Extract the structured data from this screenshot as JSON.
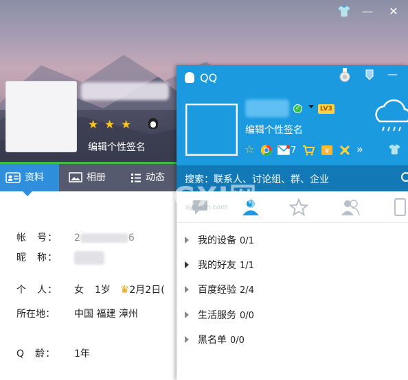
{
  "profile": {
    "window_controls": {
      "skin": "👕",
      "minimize": "—",
      "close": "✕"
    },
    "rating_stars": 3,
    "signature": "编辑个性签名",
    "tabs": [
      {
        "label": "资料",
        "icon": "id-card-icon"
      },
      {
        "label": "相册",
        "icon": "photo-icon"
      },
      {
        "label": "动态",
        "icon": "feed-icon"
      }
    ],
    "info": {
      "account_label": "帐　号：",
      "account_value_prefix": "2",
      "account_value_suffix": "6",
      "nickname_label": "昵　称：",
      "person_label": "个　人：",
      "gender": "女",
      "age": "1岁",
      "birthday": "2月2日(",
      "location_label": "所在地：",
      "location": "中国 福建 漳州",
      "qage_label": "Q　龄：",
      "qage": "1年"
    }
  },
  "qq_panel": {
    "title": "QQ",
    "level_badge": "LV3",
    "signature": "编辑个性签名",
    "mail_count": "7",
    "more": "»",
    "search_placeholder": "搜索：联系人、讨论组、群、企业",
    "groups": [
      {
        "name": "我的设备",
        "count": "0/1"
      },
      {
        "name": "我的好友",
        "count": "1/1"
      },
      {
        "name": "百度经验",
        "count": "2/4"
      },
      {
        "name": "生活服务",
        "count": "0/0"
      },
      {
        "name": "黑名单",
        "count": "0/0"
      }
    ]
  },
  "watermark": {
    "logo": "GXI网",
    "url": "system.com"
  },
  "colors": {
    "qq_blue": "#1b9ae0",
    "search_blue": "#1279b6",
    "tab_active": "#2f8fdc",
    "star": "#ffc41c"
  }
}
